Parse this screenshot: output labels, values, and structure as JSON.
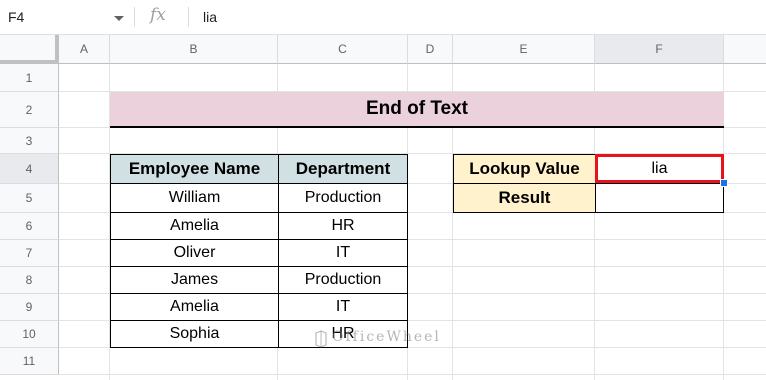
{
  "formula_bar": {
    "cell_ref": "F4",
    "fx": "fx",
    "value": "lia"
  },
  "columns": [
    "A",
    "B",
    "C",
    "D",
    "E",
    "F"
  ],
  "rows": [
    "1",
    "2",
    "3",
    "4",
    "5",
    "6",
    "7",
    "8",
    "9",
    "10",
    "11"
  ],
  "sheet": {
    "title": "End of Text",
    "table": {
      "headers": [
        "Employee Name",
        "Department"
      ],
      "rows": [
        [
          "William",
          "Production"
        ],
        [
          "Amelia",
          "HR"
        ],
        [
          "Oliver",
          "IT"
        ],
        [
          "James",
          "Production"
        ],
        [
          "Amelia",
          "IT"
        ],
        [
          "Sophia",
          "HR"
        ]
      ]
    },
    "lookup": {
      "label": "Lookup Value",
      "value": "lia"
    },
    "result": {
      "label": "Result",
      "value": ""
    }
  },
  "watermark": "OfficeWheel",
  "colors": {
    "title_bg": "#ead1dc",
    "header_bg": "#d0e0e3",
    "lookup_bg": "#fff2cc",
    "selection": "#e8121a"
  }
}
